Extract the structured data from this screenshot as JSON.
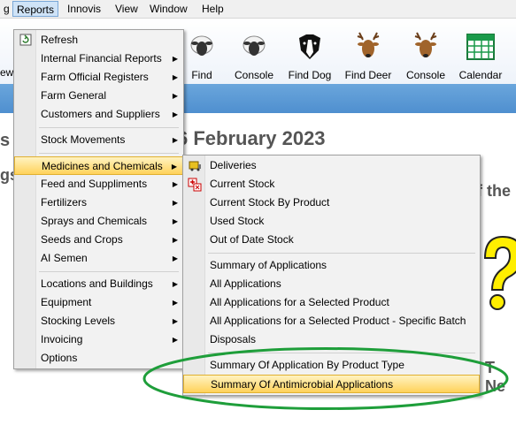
{
  "menubar": {
    "items": [
      "g",
      "Reports",
      "Innovis",
      "View",
      "Window",
      "Help"
    ]
  },
  "toolbar": {
    "partial_label": "ew",
    "buttons": [
      {
        "label": "Find",
        "icon": "sheep-icon"
      },
      {
        "label": "Console",
        "icon": "sheep-icon"
      },
      {
        "label": "Find Dog",
        "icon": "dog-icon"
      },
      {
        "label": "Find Deer",
        "icon": "deer-icon"
      },
      {
        "label": "Console",
        "icon": "deer-icon"
      },
      {
        "label": "Calendar",
        "icon": "calendar-icon"
      }
    ]
  },
  "content": {
    "headline": "6 February 2023",
    "frag_left1": "s",
    "frag_left2": "gs",
    "frag_right": "f the",
    "frag_right2": "T Ne"
  },
  "reports_menu": {
    "items": [
      {
        "label": "Refresh",
        "submenu": false
      },
      {
        "label": "Internal Financial Reports",
        "submenu": true
      },
      {
        "label": "Farm Official Registers",
        "submenu": true
      },
      {
        "label": "Farm General",
        "submenu": true
      },
      {
        "label": "Customers and Suppliers",
        "submenu": true
      },
      {
        "label": "Stock Movements",
        "submenu": true
      },
      {
        "label": "Medicines and Chemicals",
        "submenu": true,
        "highlighted": true
      },
      {
        "label": "Feed and Suppliments",
        "submenu": true
      },
      {
        "label": "Fertilizers",
        "submenu": true
      },
      {
        "label": "Sprays and Chemicals",
        "submenu": true
      },
      {
        "label": "Seeds and Crops",
        "submenu": true
      },
      {
        "label": "AI Semen",
        "submenu": true
      },
      {
        "label": "Locations and Buildings",
        "submenu": true
      },
      {
        "label": "Equipment",
        "submenu": true
      },
      {
        "label": "Stocking Levels",
        "submenu": true
      },
      {
        "label": "Invoicing",
        "submenu": true
      },
      {
        "label": "Options",
        "submenu": false
      }
    ]
  },
  "medicines_submenu": {
    "items": [
      {
        "label": "Deliveries"
      },
      {
        "label": "Current Stock"
      },
      {
        "label": "Current Stock By Product"
      },
      {
        "label": "Used Stock"
      },
      {
        "label": "Out of Date Stock"
      },
      {
        "label": "Summary of Applications"
      },
      {
        "label": "All Applications"
      },
      {
        "label": "All Applications for a Selected Product"
      },
      {
        "label": "All Applications for a Selected Product - Specific Batch"
      },
      {
        "label": "Disposals"
      },
      {
        "label": "Summary  Of Application By Product Type"
      },
      {
        "label": "Summary Of  Antimicrobial Applications",
        "highlighted": true
      }
    ]
  },
  "colors": {
    "highlight": "#ffd25a",
    "annotation_ellipse": "#1e9e3a",
    "banner": "#4f8fcf"
  }
}
